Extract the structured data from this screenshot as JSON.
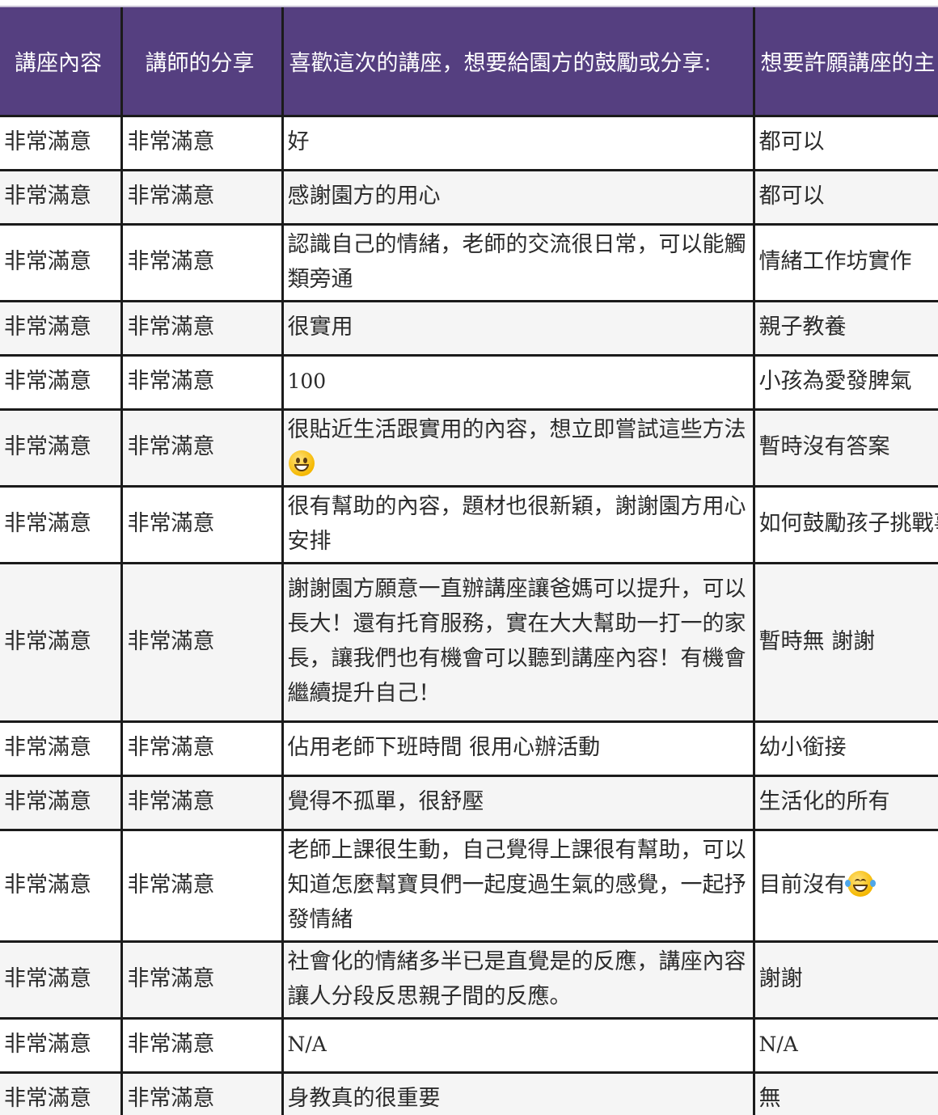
{
  "table": {
    "headers": [
      "講座內容",
      "講師的分享",
      "喜歡這次的講座，想要給園方的鼓勵或分享:",
      "想要許願講座的主"
    ],
    "rows": [
      [
        "非常滿意",
        "非常滿意",
        "好",
        "都可以"
      ],
      [
        "非常滿意",
        "非常滿意",
        "感謝園方的用心",
        "都可以"
      ],
      [
        "非常滿意",
        "非常滿意",
        "認識自己的情緒，老師的交流很日常，可以能觸類旁通",
        "情緒工作坊實作"
      ],
      [
        "非常滿意",
        "非常滿意",
        "很實用",
        "親子教養"
      ],
      [
        "非常滿意",
        "非常滿意",
        "100",
        "小孩為愛發脾氣"
      ],
      [
        "非常滿意",
        "非常滿意",
        "很貼近生活跟實用的內容，想立即嘗試這些方法",
        "暫時沒有答案"
      ],
      [
        "非常滿意",
        "非常滿意",
        "很有幫助的內容，題材也很新穎，謝謝園方用心安排",
        "如何鼓勵孩子挑戰事"
      ],
      [
        "非常滿意",
        "非常滿意",
        "謝謝園方願意一直辦講座讓爸媽可以提升，可以長大！還有托育服務，實在大大幫助一打一的家長，讓我們也有機會可以聽到講座內容！有機會繼續提升自己！",
        "暫時無 謝謝"
      ],
      [
        "非常滿意",
        "非常滿意",
        "佔用老師下班時間 很用心辦活動",
        "幼小銜接"
      ],
      [
        "非常滿意",
        "非常滿意",
        "覺得不孤單，很舒壓",
        "生活化的所有"
      ],
      [
        "非常滿意",
        "非常滿意",
        "老師上課很生動，自己覺得上課很有幫助，可以知道怎麼幫寶貝們一起度過生氣的感覺，一起抒發情緒",
        "目前沒有"
      ],
      [
        "非常滿意",
        "非常滿意",
        "社會化的情緒多半已是直覺是的反應，講座內容讓人分段反思親子間的反應。",
        "謝謝"
      ],
      [
        "非常滿意",
        "非常滿意",
        "N/A",
        "N/A"
      ],
      [
        "非常滿意",
        "非常滿意",
        "身教真的很重要",
        "無"
      ]
    ]
  },
  "emoji_icons": {
    "row6_col3": "grinning-face-icon",
    "row11_col4": "face-with-tears-of-joy-icon"
  },
  "colors": {
    "header_bg": "#553f80",
    "header_text": "#ffffff",
    "grid_line": "#1b1b1b",
    "zebra_row": "#f5f5f5"
  }
}
